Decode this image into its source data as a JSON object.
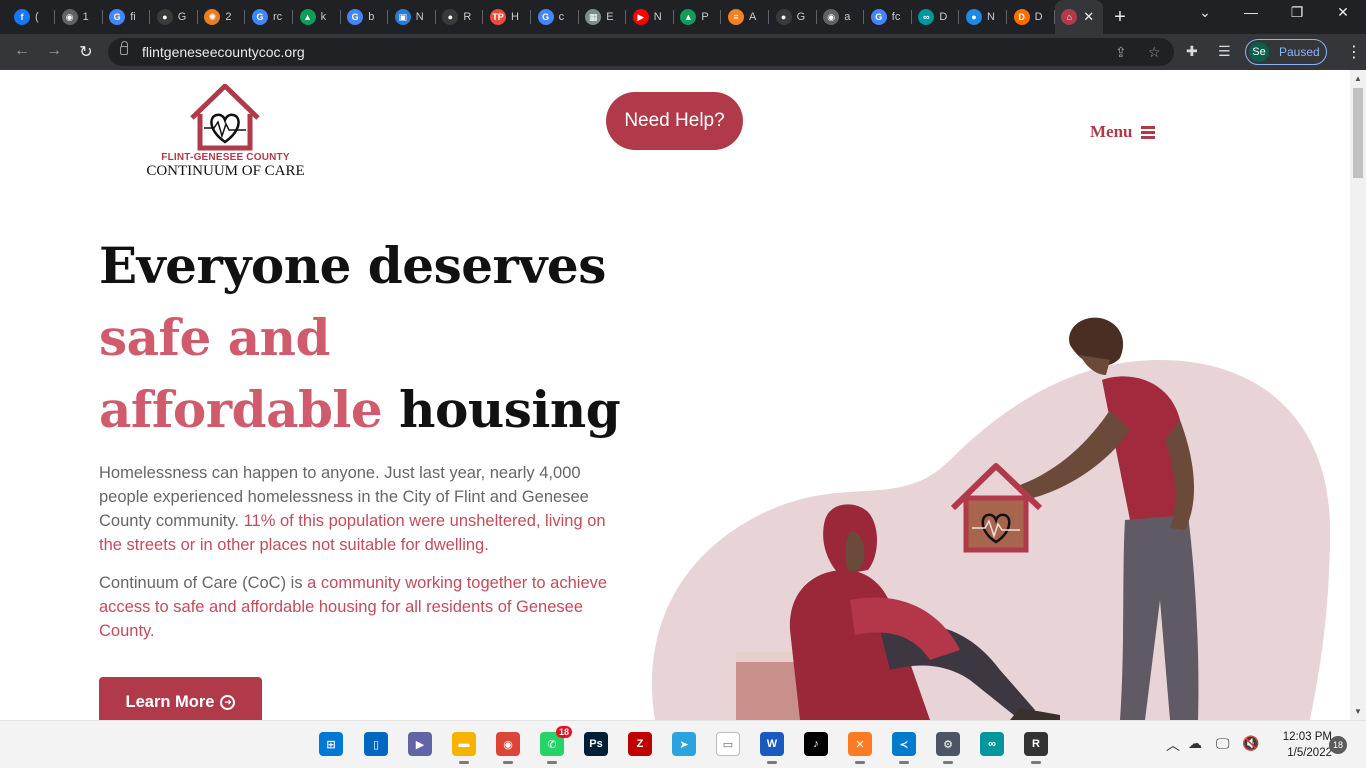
{
  "browser": {
    "tabs": [
      {
        "icon": "facebook-icon",
        "label": "(",
        "color": "#1877f2",
        "glyph": "f"
      },
      {
        "icon": "globe-icon",
        "label": "1",
        "color": "#5f6368",
        "glyph": "◉"
      },
      {
        "icon": "google-icon",
        "label": "fi",
        "color": "#4285f4",
        "glyph": "G"
      },
      {
        "icon": "github-icon",
        "label": "G",
        "color": "#3a3a3a",
        "glyph": "●"
      },
      {
        "icon": "gear-icon",
        "label": "2",
        "color": "#e67e22",
        "glyph": "✺"
      },
      {
        "icon": "google-icon",
        "label": "rc",
        "color": "#4285f4",
        "glyph": "G"
      },
      {
        "icon": "drive-icon",
        "label": "k",
        "color": "#0f9d58",
        "glyph": "▲"
      },
      {
        "icon": "google-icon",
        "label": "b",
        "color": "#4285f4",
        "glyph": "G"
      },
      {
        "icon": "image-icon",
        "label": "N",
        "color": "#2a7bd4",
        "glyph": "▣"
      },
      {
        "icon": "github-icon",
        "label": "R",
        "color": "#3a3a3a",
        "glyph": "●"
      },
      {
        "icon": "tp-icon",
        "label": "H",
        "color": "#e74c3c",
        "glyph": "TP"
      },
      {
        "icon": "google-icon",
        "label": "c",
        "color": "#4285f4",
        "glyph": "G"
      },
      {
        "icon": "table-icon",
        "label": "E",
        "color": "#7f8c8d",
        "glyph": "▦"
      },
      {
        "icon": "youtube-icon",
        "label": "N",
        "color": "#ff0000",
        "glyph": "▶"
      },
      {
        "icon": "drive-icon",
        "label": "P",
        "color": "#0f9d58",
        "glyph": "▲"
      },
      {
        "icon": "stack-icon",
        "label": "A",
        "color": "#f48024",
        "glyph": "≡"
      },
      {
        "icon": "github-icon",
        "label": "G",
        "color": "#3a3a3a",
        "glyph": "●"
      },
      {
        "icon": "globe-icon",
        "label": "a",
        "color": "#5f6368",
        "glyph": "◉"
      },
      {
        "icon": "google-icon",
        "label": "fc",
        "color": "#4285f4",
        "glyph": "G"
      },
      {
        "icon": "infinity-icon",
        "label": "D",
        "color": "#00979d",
        "glyph": "∞"
      },
      {
        "icon": "location-icon",
        "label": "N",
        "color": "#1e88e5",
        "glyph": "●"
      },
      {
        "icon": "d-icon",
        "label": "D",
        "color": "#ff6d00",
        "glyph": "D"
      }
    ],
    "active_tab_icon": "house-icon",
    "close_glyph": "✕",
    "new_tab_glyph": "+",
    "url": "flintgeneseecountycoc.org",
    "profile_initials": "Se",
    "profile_status": "Paused"
  },
  "header": {
    "logo_line1": "FLINT-GENESEE COUNTY",
    "logo_line2": "CONTINUUM OF CARE",
    "need_help": "Need Help?",
    "menu": "Menu"
  },
  "hero": {
    "title_line1": "Everyone deserves",
    "title_line2": "safe and",
    "title_line3_pink": "affordable",
    "title_line3_dark": " housing",
    "para1_plain": "Homelessness can happen to anyone. Just last year, nearly 4,000 people experienced homelessness in the City of Flint and Genesee County community. ",
    "para1_pink": "11% of this population were unsheltered, living on the streets or in other places not suitable for dwelling.",
    "para2_plain": "Continuum of Care (CoC) is ",
    "para2_pink": "a community working together to achieve access to safe and affordable housing for all residents of Genesee County.",
    "cta": "Learn More",
    "cta_icon": "arrow-circle-right-icon"
  },
  "taskbar": {
    "apps": [
      {
        "name": "start-button",
        "glyph": "⊞",
        "color": "#0078d4"
      },
      {
        "name": "task-view-button",
        "glyph": "▯",
        "color": "#0067c0"
      },
      {
        "name": "teams-chat-button",
        "glyph": "▶",
        "color": "#6264a7"
      },
      {
        "name": "file-explorer-button",
        "glyph": "▬",
        "color": "#f5b400"
      },
      {
        "name": "chrome-button",
        "glyph": "◉",
        "color": "#db4437"
      },
      {
        "name": "whatsapp-button",
        "glyph": "✆",
        "color": "#25d366",
        "badge": "18"
      },
      {
        "name": "photoshop-button",
        "glyph": "Ps",
        "color": "#001e36"
      },
      {
        "name": "filezilla-button",
        "glyph": "Z",
        "color": "#bf0000"
      },
      {
        "name": "telegram-button",
        "glyph": "➤",
        "color": "#2aa3df"
      },
      {
        "name": "notepad-button",
        "glyph": "▭",
        "color": "#ffffff"
      },
      {
        "name": "word-button",
        "glyph": "W",
        "color": "#185abd"
      },
      {
        "name": "tiktok-button",
        "glyph": "♪",
        "color": "#000000"
      },
      {
        "name": "xampp-button",
        "glyph": "✕",
        "color": "#fb7a24"
      },
      {
        "name": "vscode-button",
        "glyph": "≺",
        "color": "#007acc"
      },
      {
        "name": "settings-button",
        "glyph": "⚙",
        "color": "#4b5563"
      },
      {
        "name": "arduino-button",
        "glyph": "∞",
        "color": "#00979d"
      },
      {
        "name": "app-r-button",
        "glyph": "R",
        "color": "#333333"
      }
    ],
    "time": "12:03 PM",
    "date": "1/5/2022",
    "notifications": "18"
  },
  "colors": {
    "accent": "#b13a4a",
    "hero_pink": "#cf5b6d",
    "blob": "#e8d3d6"
  }
}
